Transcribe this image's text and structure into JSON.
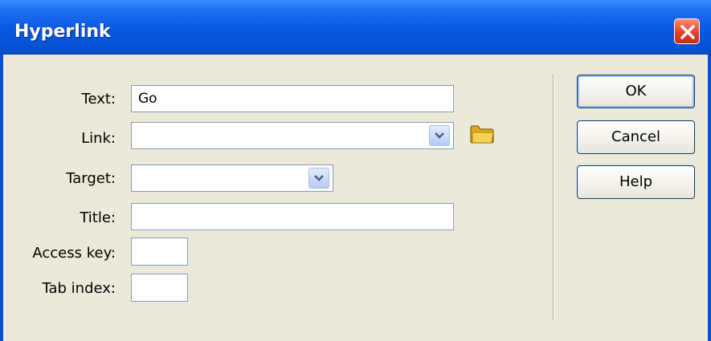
{
  "window": {
    "title": "Hyperlink",
    "close_icon": "close-icon"
  },
  "form": {
    "text_label": "Text:",
    "text_value": "Go",
    "link_label": "Link:",
    "link_value": "",
    "target_label": "Target:",
    "target_value": "",
    "title_label": "Title:",
    "title_value": "",
    "access_key_label": "Access key:",
    "access_key_value": "",
    "tab_index_label": "Tab index:",
    "tab_index_value": ""
  },
  "buttons": {
    "ok": "OK",
    "cancel": "Cancel",
    "help": "Help"
  },
  "icons": {
    "browse": "folder-icon",
    "dropdown": "chevron-down-icon"
  },
  "colors": {
    "titlebar": "#0a58e2",
    "dialog_bg": "#ece9d8",
    "close": "#e2432a"
  }
}
